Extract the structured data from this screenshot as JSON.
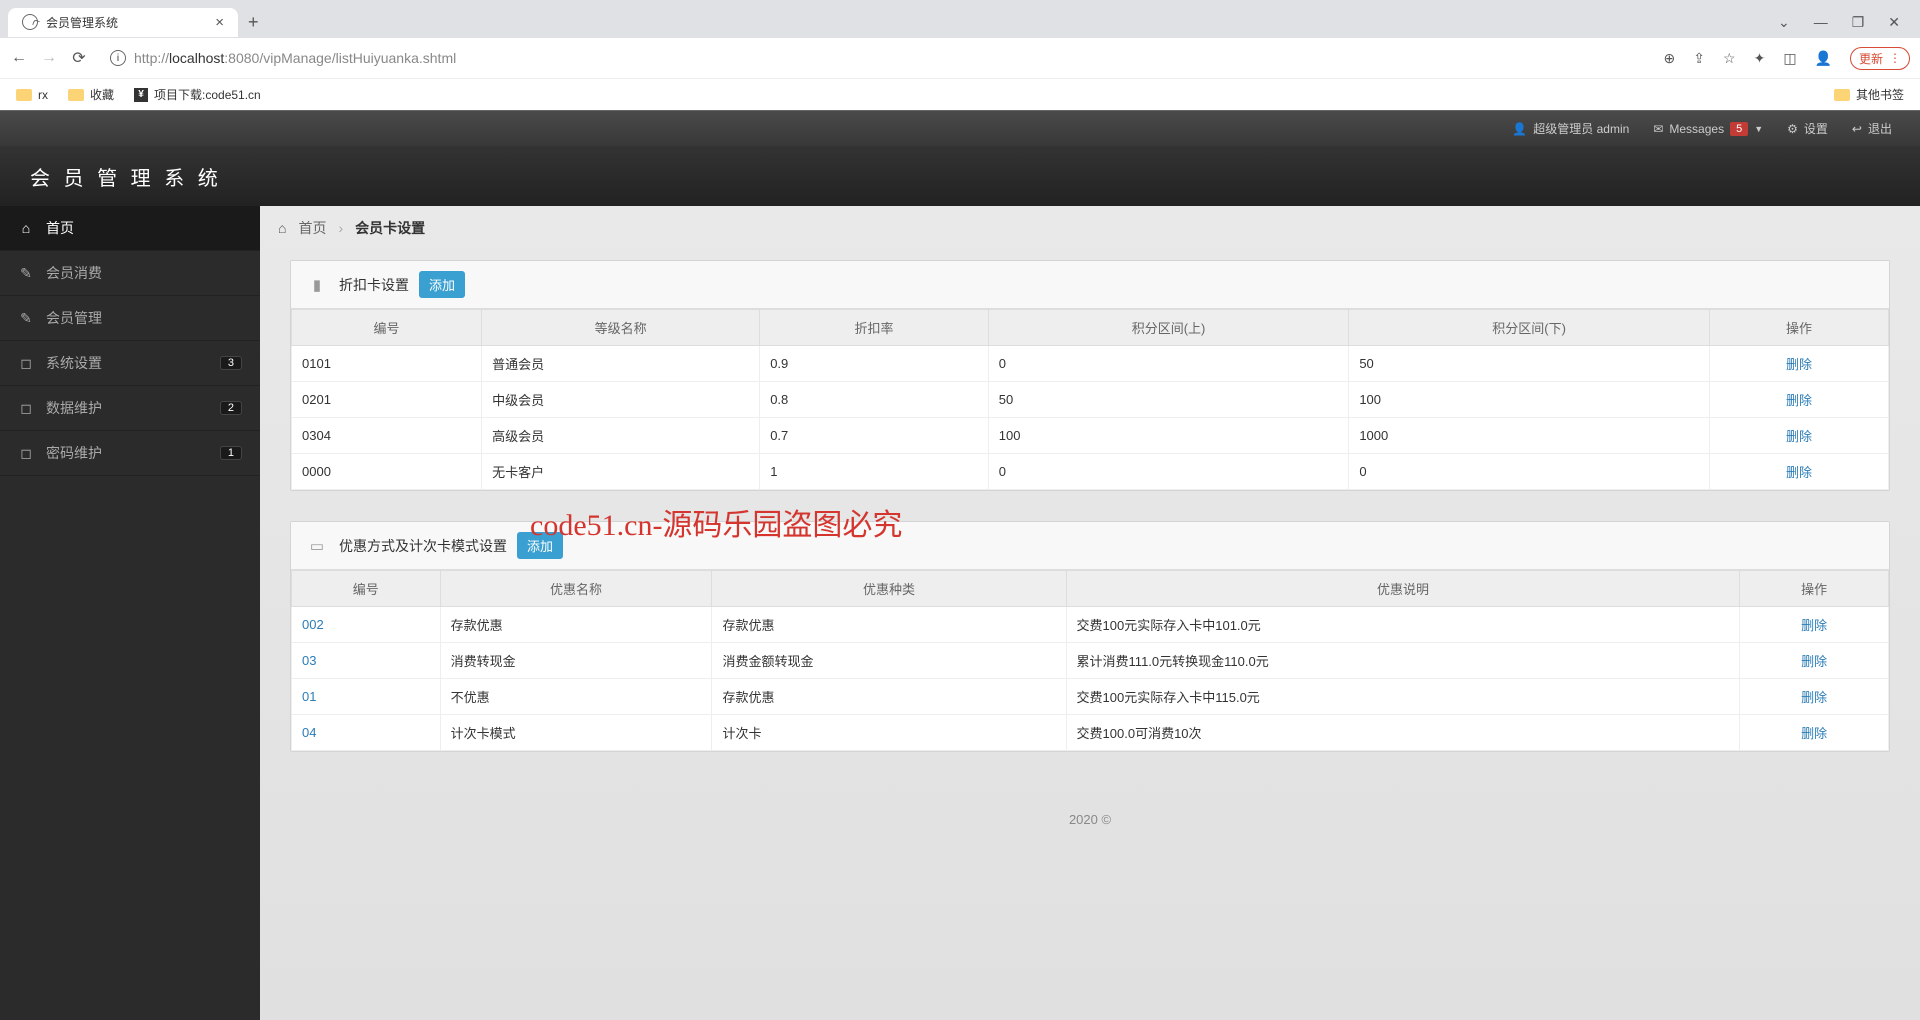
{
  "browser": {
    "tab_title": "会员管理系统",
    "url_grey_prefix": "http://",
    "url_host": "localhost",
    "url_port": ":8080",
    "url_path": "/vipManage/listHuiyuanka.shtml",
    "update_btn": "更新",
    "bookmarks": {
      "b1": "rx",
      "b2": "收藏",
      "b3": "项目下载:code51.cn",
      "other": "其他书签"
    }
  },
  "topnav": {
    "user": "超级管理员 admin",
    "messages": "Messages",
    "msg_count": "5",
    "settings": "设置",
    "logout": "退出"
  },
  "brand": "会 员 管 理 系 统",
  "sidebar": {
    "items": [
      {
        "label": "首页",
        "icon": "⌂",
        "active": true,
        "badge": ""
      },
      {
        "label": "会员消费",
        "icon": "✎",
        "active": false,
        "badge": ""
      },
      {
        "label": "会员管理",
        "icon": "✎",
        "active": false,
        "badge": ""
      },
      {
        "label": "系统设置",
        "icon": "◻",
        "active": false,
        "badge": "3"
      },
      {
        "label": "数据维护",
        "icon": "◻",
        "active": false,
        "badge": "2"
      },
      {
        "label": "密码维护",
        "icon": "◻",
        "active": false,
        "badge": "1"
      }
    ]
  },
  "breadcrumb": {
    "home": "首页",
    "current": "会员卡设置"
  },
  "panel1": {
    "title": "折扣卡设置",
    "add": "添加",
    "headers": [
      "编号",
      "等级名称",
      "折扣率",
      "积分区间(上)",
      "积分区间(下)",
      "操作"
    ],
    "rows": [
      {
        "id": "0101",
        "name": "普通会员",
        "rate": "0.9",
        "up": "0",
        "down": "50",
        "op": "删除"
      },
      {
        "id": "0201",
        "name": "中级会员",
        "rate": "0.8",
        "up": "50",
        "down": "100",
        "op": "删除"
      },
      {
        "id": "0304",
        "name": "高级会员",
        "rate": "0.7",
        "up": "100",
        "down": "1000",
        "op": "删除"
      },
      {
        "id": "0000",
        "name": "无卡客户",
        "rate": "1",
        "up": "0",
        "down": "0",
        "op": "删除"
      }
    ]
  },
  "panel2": {
    "title": "优惠方式及计次卡模式设置",
    "add": "添加",
    "headers": [
      "编号",
      "优惠名称",
      "优惠种类",
      "优惠说明",
      "操作"
    ],
    "rows": [
      {
        "id": "002",
        "name": "存款优惠",
        "type": "存款优惠",
        "desc": "交费100元实际存入卡中101.0元",
        "op": "删除"
      },
      {
        "id": "03",
        "name": "消费转现金",
        "type": "消费金额转现金",
        "desc": "累计消费111.0元转换现金110.0元",
        "op": "删除"
      },
      {
        "id": "01",
        "name": "不优惠",
        "type": "存款优惠",
        "desc": "交费100元实际存入卡中115.0元",
        "op": "删除"
      },
      {
        "id": "04",
        "name": "计次卡模式",
        "type": "计次卡",
        "desc": "交费100.0可消费10次",
        "op": "删除"
      }
    ]
  },
  "footer": "2020 ©",
  "watermark": "code51.cn-源码乐园盗图必究"
}
